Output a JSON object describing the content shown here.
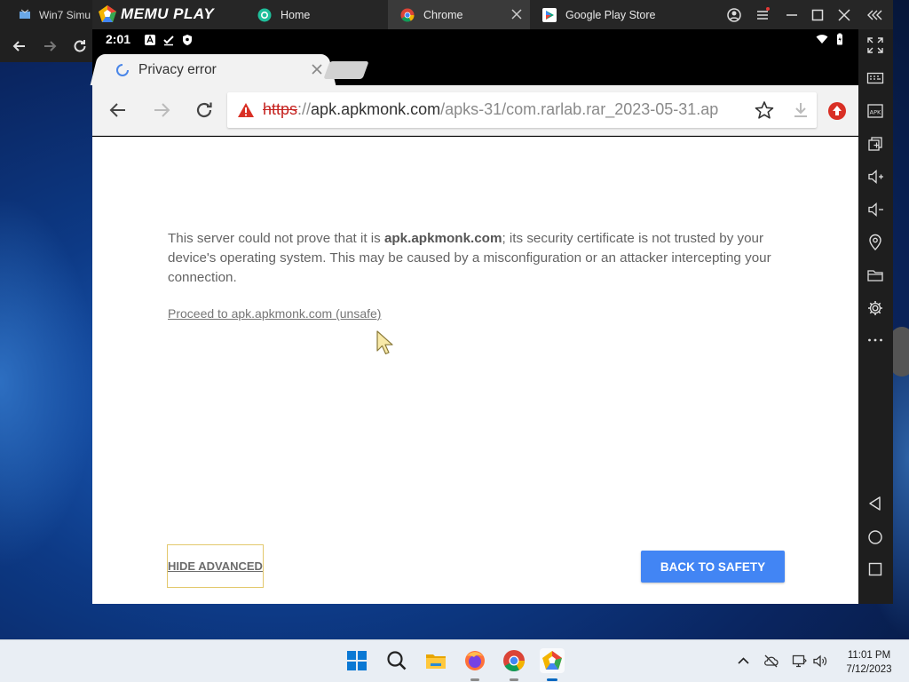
{
  "host_window": {
    "tab_label": "Win7 Simu"
  },
  "memu": {
    "brand": "MEMU PLAY",
    "tabs": [
      {
        "label": "Home",
        "icon": "home-app-icon"
      },
      {
        "label": "Chrome",
        "icon": "chrome-icon",
        "active": true
      },
      {
        "label": "Google Play Store",
        "icon": "play-store-icon"
      }
    ]
  },
  "android_status": {
    "time": "2:01"
  },
  "chrome": {
    "tab_title": "Privacy error",
    "url": {
      "scheme": "https",
      "separator": "://",
      "host": "apk.apkmonk.com",
      "path": "/apks-31/com.rarlab.rar_2023-05-31.ap"
    }
  },
  "error_page": {
    "text_before": "This server could not prove that it is ",
    "host_bold": "apk.apkmonk.com",
    "text_after": "; its security certificate is not trusted by your device's operating system. This may be caused by a misconfiguration or an attacker intercepting your connection.",
    "proceed_link": "Proceed to apk.apkmonk.com (unsafe)",
    "hide_advanced": "HIDE ADVANCED",
    "back_to_safety": "BACK TO SAFETY"
  },
  "taskbar": {
    "clock_time": "11:01 PM",
    "clock_date": "7/12/2023"
  },
  "colors": {
    "accent_button": "#4285f4",
    "url_warning": "#c5221f",
    "focus_outline": "#e3c86c"
  }
}
